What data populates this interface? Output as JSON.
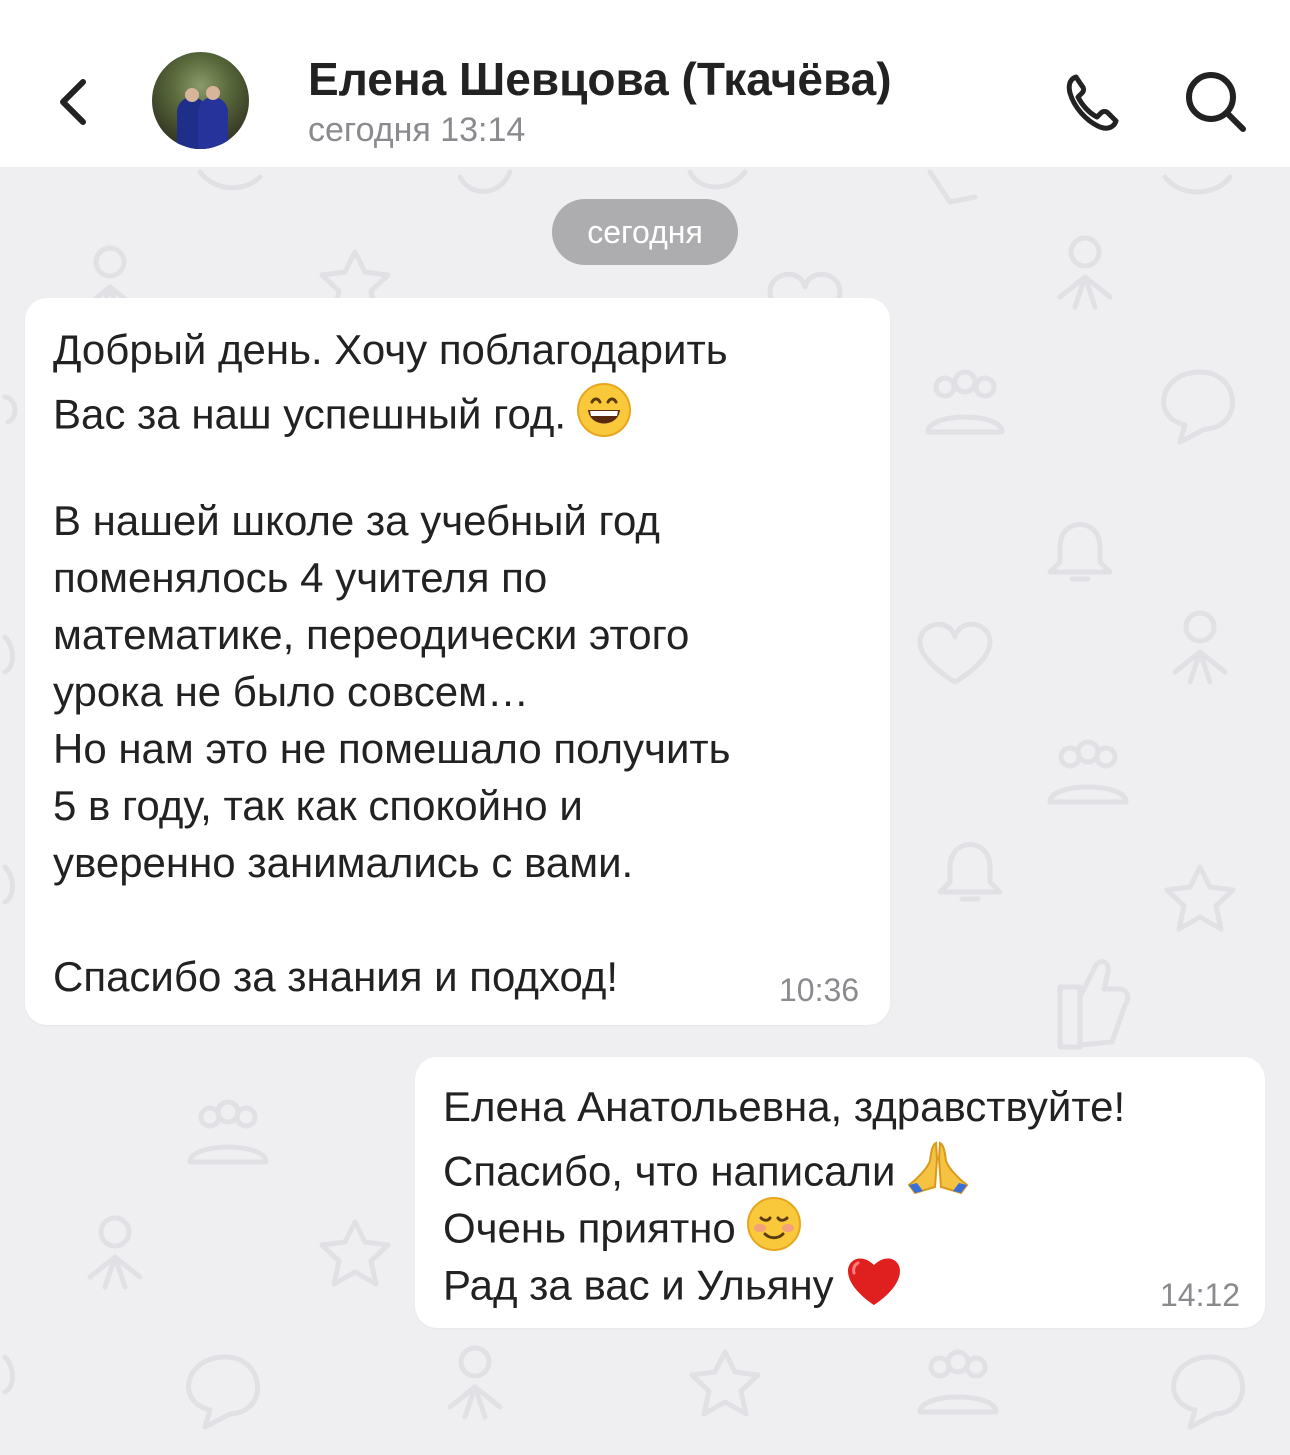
{
  "header": {
    "contact_name": "Елена Шевцова (Ткачёва)",
    "contact_status": "сегодня 13:14",
    "icons": {
      "back": "chevron-left-icon",
      "call": "phone-icon",
      "search": "search-icon"
    }
  },
  "chat": {
    "date_separator": "сегодня",
    "messages": [
      {
        "direction": "incoming",
        "lines": [
          "Добрый день. Хочу поблагодарить",
          "Вас за наш успешный год.",
          "",
          "В нашей школе за учебный год",
          "поменялось 4 учителя по",
          "математике, переодически этого",
          "урока не было совсем…",
          "Но нам это не помешало получить",
          "5 в году, так как спокойно и",
          "уверенно занимались с вами.",
          "",
          "Спасибо за знания и подход!"
        ],
        "emojis": [
          "grinning-face-emoji"
        ],
        "time": "10:36"
      },
      {
        "direction": "outgoing",
        "lines": [
          "Елена Анатольевна, здравствуйте!",
          "Спасибо, что написали",
          "Очень приятно",
          "Рад за вас и Ульяну"
        ],
        "emojis": [
          "folded-hands-emoji",
          "smiling-face-emoji",
          "red-heart-emoji"
        ],
        "time": "14:12"
      }
    ]
  },
  "colors": {
    "header_bg": "#ffffff",
    "chat_bg": "#efeff1",
    "bubble_bg": "#ffffff",
    "date_pill_bg": "#adadb0",
    "text_primary": "#222222",
    "text_secondary": "#8a8a8f"
  }
}
